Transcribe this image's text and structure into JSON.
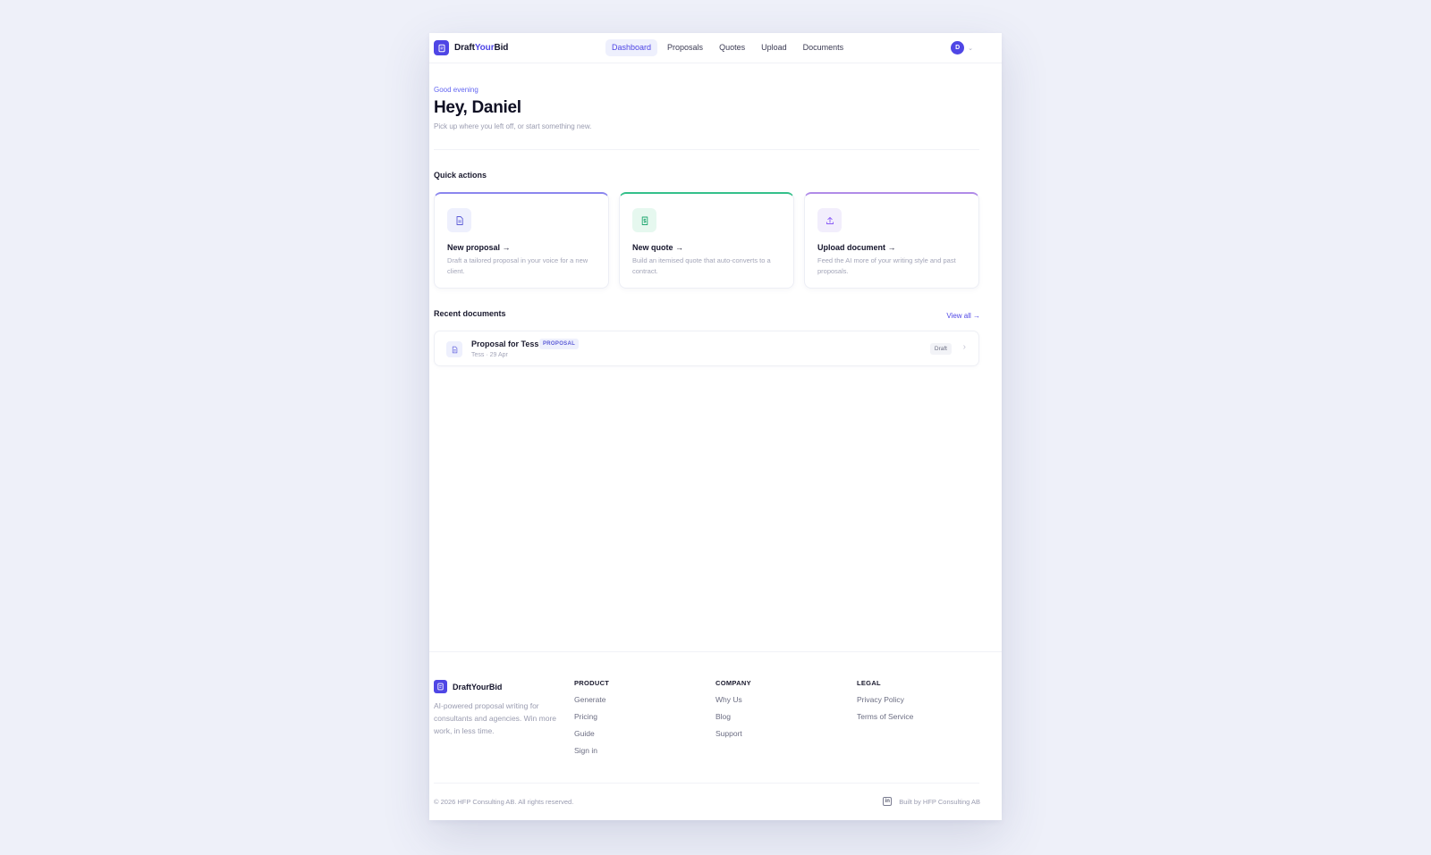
{
  "header": {
    "brand": {
      "part1": "Draft",
      "part2": "Your",
      "part3": "Bid"
    },
    "nav": [
      {
        "label": "Dashboard",
        "active": true
      },
      {
        "label": "Proposals",
        "active": false
      },
      {
        "label": "Quotes",
        "active": false
      },
      {
        "label": "Upload",
        "active": false
      },
      {
        "label": "Documents",
        "active": false
      }
    ],
    "avatar_initial": "D"
  },
  "hero": {
    "greeting": "Good evening",
    "title": "Hey, Daniel",
    "subtitle": "Pick up where you left off, or start something new."
  },
  "quick_actions": {
    "title": "Quick actions",
    "cards": [
      {
        "icon": "document-icon",
        "title": "New proposal →",
        "desc": "Draft a tailored proposal in your voice for a new client.",
        "accent": "#8b86ee"
      },
      {
        "icon": "dollar-doc-icon",
        "title": "New quote →",
        "desc": "Build an itemised quote that auto-converts to a contract.",
        "accent": "#34c08a"
      },
      {
        "icon": "upload-icon",
        "title": "Upload document →",
        "desc": "Feed the AI more of your writing style and past proposals.",
        "accent": "#b08be8"
      }
    ]
  },
  "recent": {
    "title": "Recent documents",
    "view_all": "View all →",
    "items": [
      {
        "title": "Proposal for Tess",
        "tag": "PROPOSAL",
        "meta": "Tess · 29 Apr",
        "status": "Draft"
      }
    ]
  },
  "footer": {
    "brand": "DraftYourBid",
    "description": "AI-powered proposal writing for consultants and agencies. Win more work, in less time.",
    "columns": [
      {
        "title": "PRODUCT",
        "links": [
          "Generate",
          "Pricing",
          "Guide",
          "Sign in"
        ]
      },
      {
        "title": "COMPANY",
        "links": [
          "Why Us",
          "Blog",
          "Support"
        ]
      },
      {
        "title": "LEGAL",
        "links": [
          "Privacy Policy",
          "Terms of Service"
        ]
      }
    ],
    "copyright": "© 2026 HFP Consulting AB. All rights reserved.",
    "built_by": "Built by HFP Consulting AB"
  },
  "colors": {
    "brand": "#4f46e5",
    "background": "#eef0f9"
  }
}
